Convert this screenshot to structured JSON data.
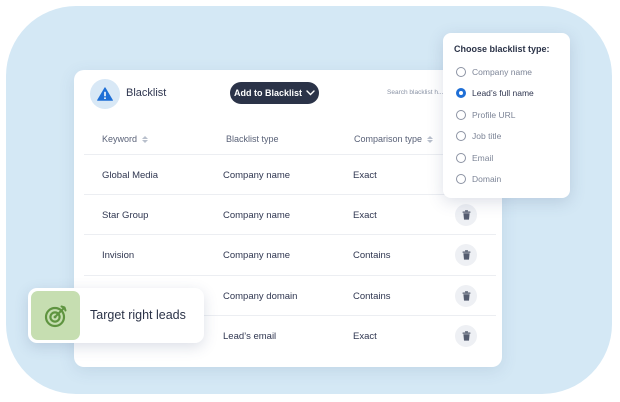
{
  "colors": {
    "backdrop": "#d4e8f5",
    "button_bg": "#2b3348",
    "warning": "#1f6fd6",
    "radio_selected": "#1f6fd6",
    "badge_accent": "#7aa85a"
  },
  "panel": {
    "title": "Blacklist",
    "add_button_label": "Add to Blacklist",
    "search_placeholder": "Search blacklist h..."
  },
  "table": {
    "columns": [
      "Keyword",
      "Blacklist type",
      "Comparison type"
    ],
    "rows": [
      {
        "keyword": "Global Media",
        "type": "Company name",
        "comparison": "Exact"
      },
      {
        "keyword": "Star Group",
        "type": "Company name",
        "comparison": "Exact"
      },
      {
        "keyword": "Invision",
        "type": "Company name",
        "comparison": "Contains"
      },
      {
        "keyword": "",
        "type": "Company domain",
        "comparison": "Contains"
      },
      {
        "keyword": "",
        "type": "Lead’s email",
        "comparison": "Exact"
      }
    ]
  },
  "dropdown": {
    "title": "Choose blacklist type:",
    "options": [
      {
        "label": "Company name",
        "selected": false
      },
      {
        "label": "Lead’s full name",
        "selected": true
      },
      {
        "label": "Profile URL",
        "selected": false
      },
      {
        "label": "Job title",
        "selected": false
      },
      {
        "label": "Email",
        "selected": false
      },
      {
        "label": "Domain",
        "selected": false
      }
    ]
  },
  "badge": {
    "label": "Target right leads",
    "icon": "target-icon"
  }
}
